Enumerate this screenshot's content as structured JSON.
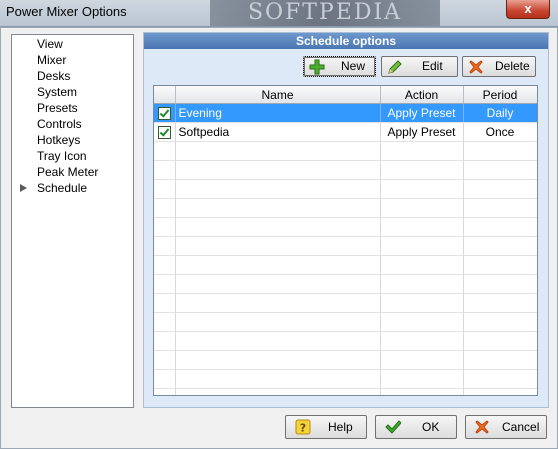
{
  "window": {
    "title": "Power Mixer Options",
    "watermark": "SOFTPEDIA",
    "close_label": "x"
  },
  "nav": {
    "items": [
      {
        "label": "View"
      },
      {
        "label": "Mixer"
      },
      {
        "label": "Desks"
      },
      {
        "label": "System"
      },
      {
        "label": "Presets"
      },
      {
        "label": "Controls"
      },
      {
        "label": "Hotkeys"
      },
      {
        "label": "Tray Icon"
      },
      {
        "label": "Peak Meter"
      },
      {
        "label": "Schedule"
      }
    ],
    "selected_index": 9
  },
  "schedule": {
    "header": "Schedule options",
    "new_label": "New",
    "edit_label": "Edit",
    "delete_label": "Delete",
    "columns": {
      "name": "Name",
      "action": "Action",
      "period": "Period"
    },
    "rows": [
      {
        "checked": true,
        "name": "Evening",
        "action": "Apply Preset",
        "period": "Daily",
        "selected": true
      },
      {
        "checked": true,
        "name": "Softpedia",
        "action": "Apply Preset",
        "period": "Once",
        "selected": false
      }
    ]
  },
  "footer": {
    "help_label": "Help",
    "ok_label": "OK",
    "cancel_label": "Cancel"
  },
  "colors": {
    "selection": "#3399ff",
    "group_header": "#4a76b3",
    "group_bg": "#dde9f7"
  }
}
